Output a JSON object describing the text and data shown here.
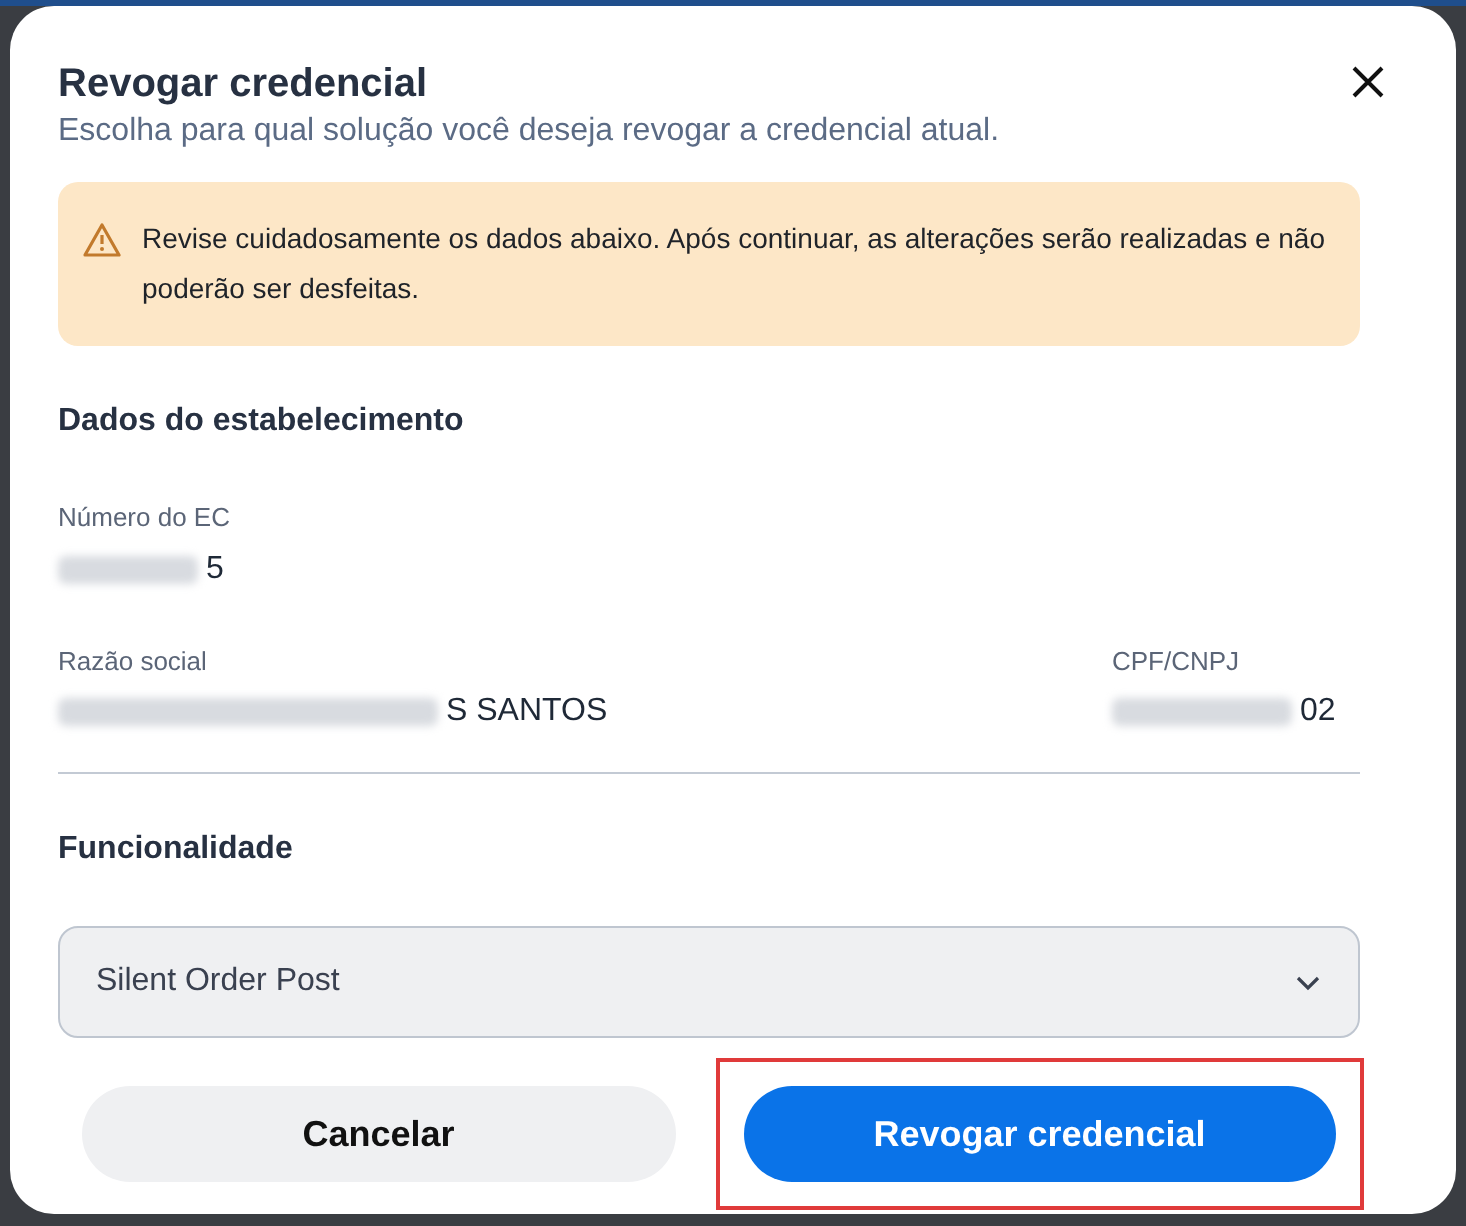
{
  "dialog": {
    "title": "Revogar credencial",
    "subtitle": "Escolha para qual solução você deseja revogar a credencial atual."
  },
  "alert": {
    "kind": "warning",
    "text": "Revise cuidadosamente os dados abaixo. Após continuar, as alterações serão realizadas e não poderão ser desfeitas."
  },
  "section": {
    "title": "Dados do estabelecimento",
    "fields": [
      {
        "label": "Número do EC",
        "value": "5",
        "redacted": true
      },
      {
        "label": "Razão social",
        "value": "S SANTOS",
        "redacted": true
      },
      {
        "label": "CPF/CNPJ",
        "value": "02",
        "redacted": true
      }
    ]
  },
  "functionality": {
    "title": "Funcionalidade",
    "select": {
      "value": "Silent Order Post"
    }
  },
  "buttons": [
    {
      "label": "Cancelar",
      "kind": "secondary",
      "highlighted": false
    },
    {
      "label": "Revogar credencial",
      "kind": "primary",
      "highlighted": true
    }
  ]
}
